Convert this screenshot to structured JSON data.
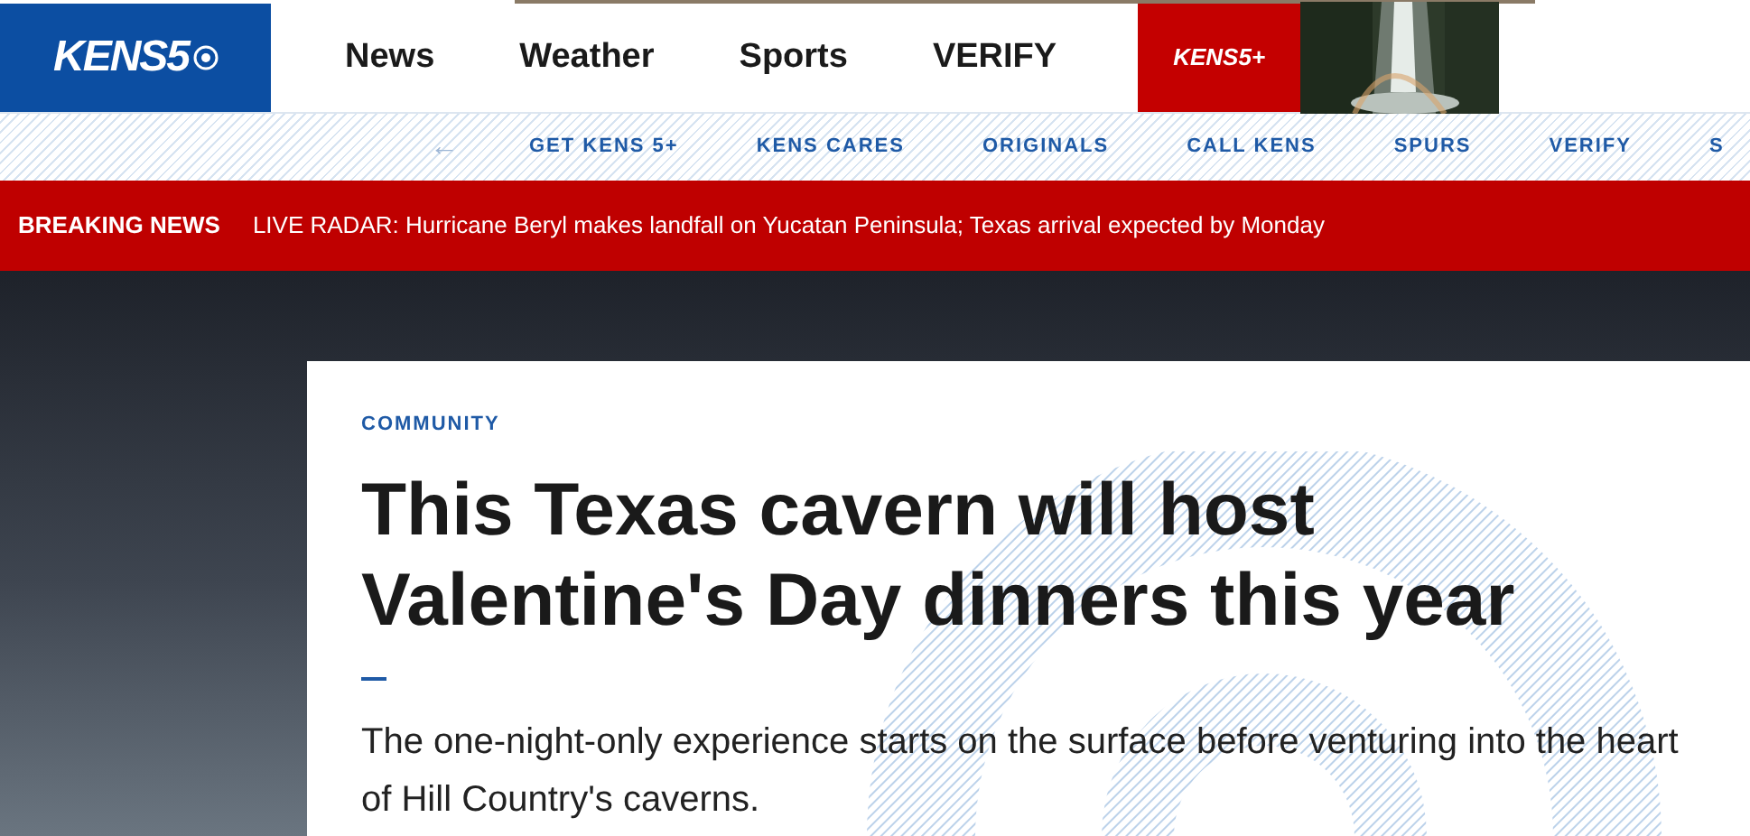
{
  "logo": {
    "text": "KENS5"
  },
  "main_nav": [
    {
      "label": "News"
    },
    {
      "label": "Weather"
    },
    {
      "label": "Sports"
    },
    {
      "label": "VERIFY"
    }
  ],
  "promo": {
    "logo_text": "KENS5+",
    "kind": "picture"
  },
  "sub_nav": {
    "back_arrow": "←",
    "items": [
      {
        "label": "GET KENS 5+"
      },
      {
        "label": "KENS CARES"
      },
      {
        "label": "ORIGINALS"
      },
      {
        "label": "CALL KENS"
      },
      {
        "label": "SPURS"
      },
      {
        "label": "VERIFY"
      },
      {
        "label": "S"
      }
    ]
  },
  "breaking_news": {
    "label": "BREAKING NEWS",
    "headline": "LIVE RADAR: Hurricane Beryl makes landfall on Yucatan Peninsula; Texas arrival expected by Monday"
  },
  "article": {
    "category": "COMMUNITY",
    "headline": "This Texas cavern will host Valentine's Day dinners this year",
    "summary": "The one-night-only experience starts on the surface before venturing into the heart of Hill Country's caverns."
  }
}
